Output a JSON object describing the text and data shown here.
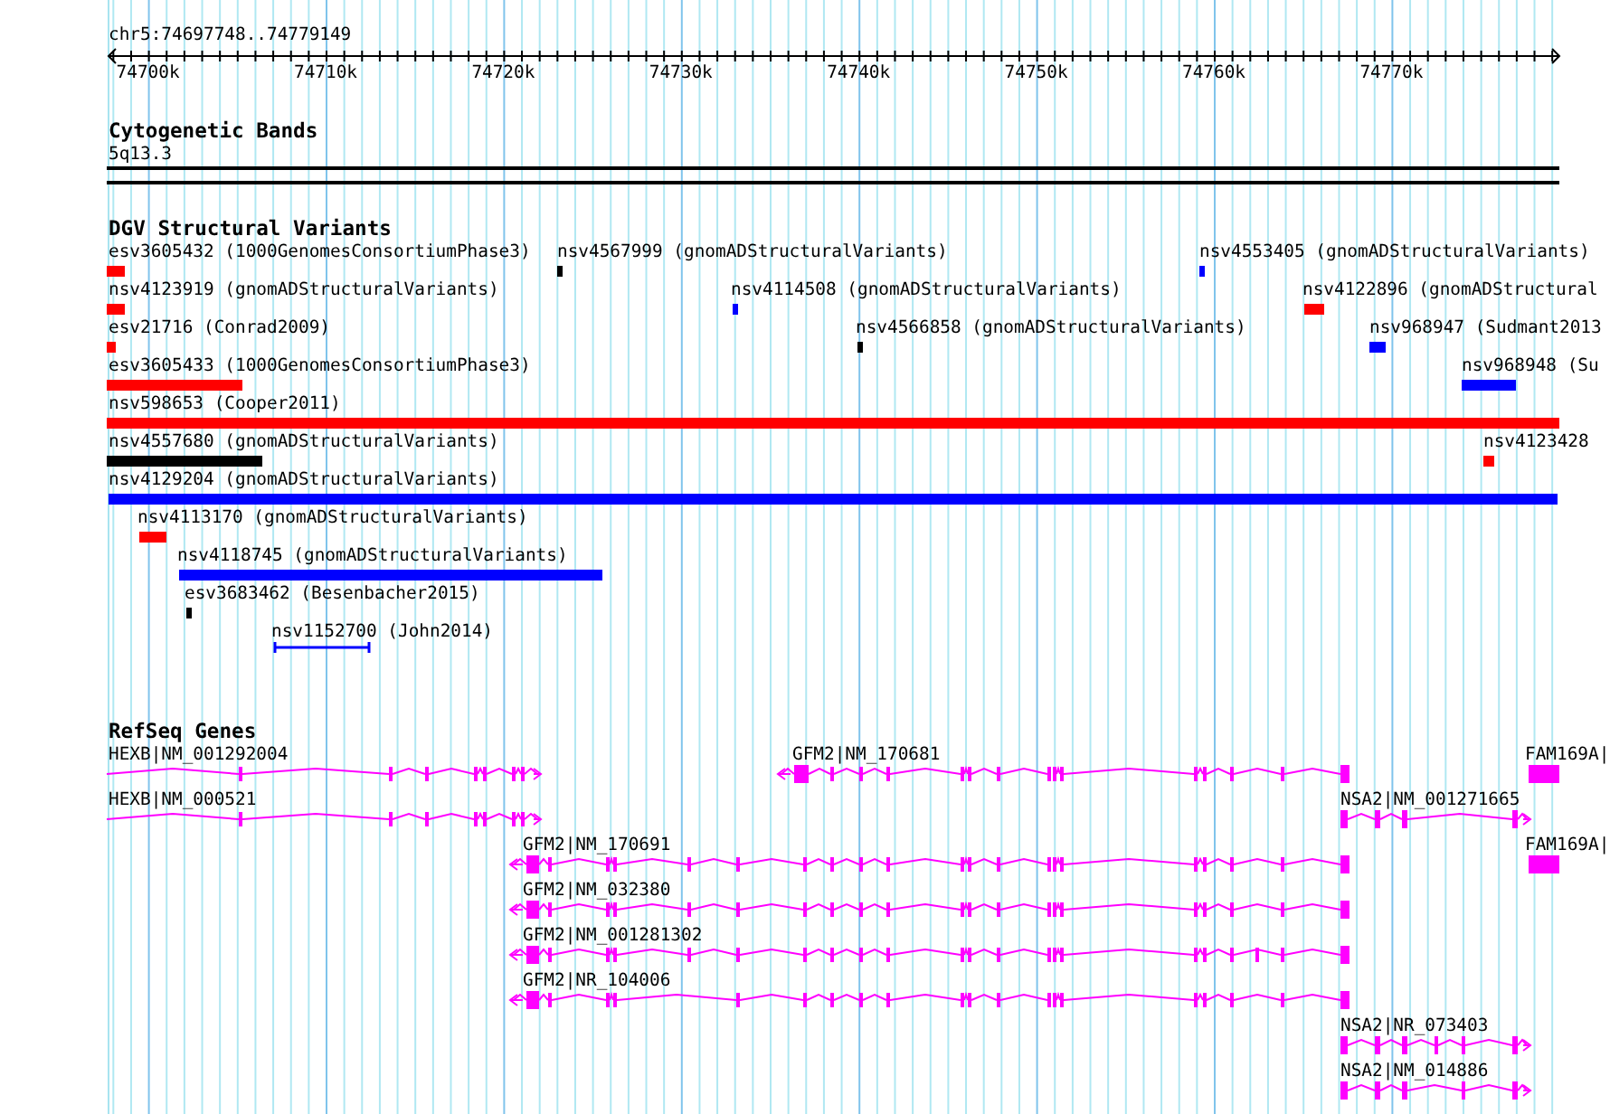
{
  "ruler": {
    "location": "chr5:74697748..74779149",
    "ticks": [
      "74700k",
      "74710k",
      "74720k",
      "74730k",
      "74740k",
      "74750k",
      "74760k",
      "74770k"
    ]
  },
  "cytogenetic_bands": {
    "title": "Cytogenetic Bands",
    "features": [
      {
        "label": "5q13.3"
      }
    ]
  },
  "dgv_structural_variants": {
    "title": "DGV Structural Variants",
    "features": [
      {
        "label": "esv3605432 (1000GenomesConsortiumPhase3)",
        "kind": "bar",
        "color": "#ff0000"
      },
      {
        "label": "nsv4567999 (gnomADStructuralVariants)",
        "kind": "bar",
        "color": "#000000"
      },
      {
        "label": "nsv4553405 (gnomADStructuralVariants)",
        "kind": "bar",
        "color": "#0000ff"
      },
      {
        "label": "nsv4123919 (gnomADStructuralVariants)",
        "kind": "bar",
        "color": "#ff0000"
      },
      {
        "label": "nsv4114508 (gnomADStructuralVariants)",
        "kind": "bar",
        "color": "#0000ff"
      },
      {
        "label": "nsv4122896 (gnomADStructural",
        "kind": "bar",
        "color": "#ff0000"
      },
      {
        "label": "esv21716 (Conrad2009)",
        "kind": "bar",
        "color": "#ff0000"
      },
      {
        "label": "nsv4566858 (gnomADStructuralVariants)",
        "kind": "bar",
        "color": "#000000"
      },
      {
        "label": "nsv968947 (Sudmant2013",
        "kind": "bar",
        "color": "#0000ff"
      },
      {
        "label": "esv3605433 (1000GenomesConsortiumPhase3)",
        "kind": "bar",
        "color": "#ff0000"
      },
      {
        "label": "nsv968948 (Su",
        "kind": "bar",
        "color": "#0000ff"
      },
      {
        "label": "nsv598653 (Cooper2011)",
        "kind": "bar",
        "color": "#ff0000"
      },
      {
        "label": "nsv4557680 (gnomADStructuralVariants)",
        "kind": "bar",
        "color": "#000000"
      },
      {
        "label": "nsv4123428",
        "kind": "bar",
        "color": "#ff0000"
      },
      {
        "label": "nsv4129204 (gnomADStructuralVariants)",
        "kind": "bar",
        "color": "#0000ff"
      },
      {
        "label": "nsv4113170 (gnomADStructuralVariants)",
        "kind": "bar",
        "color": "#ff0000"
      },
      {
        "label": "nsv4118745 (gnomADStructuralVariants)",
        "kind": "bar",
        "color": "#0000ff"
      },
      {
        "label": "esv3683462 (Besenbacher2015)",
        "kind": "bar",
        "color": "#000000"
      },
      {
        "label": "nsv1152700 (John2014)",
        "kind": "span",
        "color": "#0000ff"
      }
    ]
  },
  "refseq_genes": {
    "title": "RefSeq Genes",
    "features": [
      {
        "label": "HEXB|NM_001292004",
        "kind": "transcript",
        "reverse": false
      },
      {
        "label": "GFM2|NM_170681",
        "kind": "transcript",
        "reverse": true
      },
      {
        "label": "FAM169A|",
        "kind": "partial"
      },
      {
        "label": "HEXB|NM_000521",
        "kind": "transcript",
        "reverse": false
      },
      {
        "label": "NSA2|NM_001271665",
        "kind": "transcript",
        "reverse": false
      },
      {
        "label": "GFM2|NM_170691",
        "kind": "transcript",
        "reverse": true
      },
      {
        "label": "FAM169A|",
        "kind": "partial"
      },
      {
        "label": "GFM2|NM_032380",
        "kind": "transcript",
        "reverse": true
      },
      {
        "label": "GFM2|NM_001281302",
        "kind": "transcript",
        "reverse": true
      },
      {
        "label": "GFM2|NR_104006",
        "kind": "transcript",
        "reverse": true
      },
      {
        "label": "NSA2|NR_073403",
        "kind": "transcript",
        "reverse": false
      },
      {
        "label": "NSA2|NM_014886",
        "kind": "transcript",
        "reverse": false
      }
    ]
  }
}
